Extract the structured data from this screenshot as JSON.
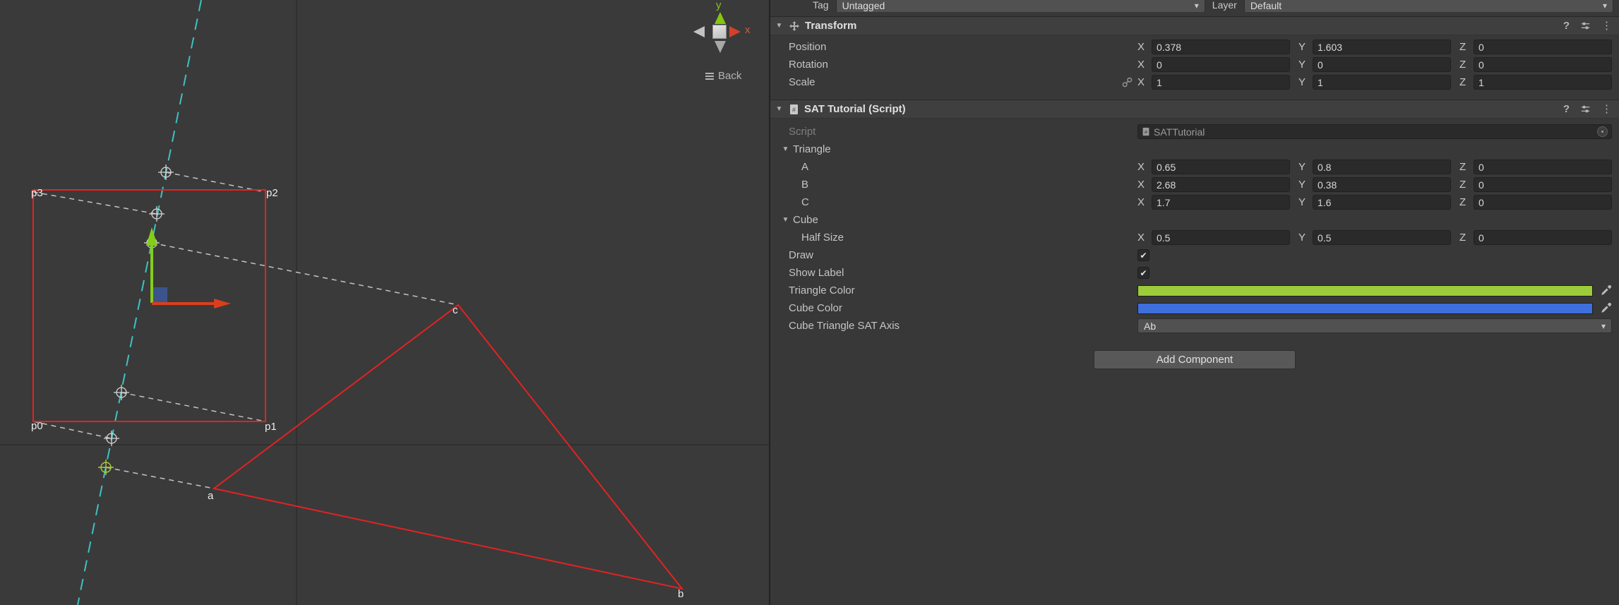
{
  "icons": {
    "help": "?",
    "more": "⋮",
    "caret": "▾",
    "check": "✔",
    "foldout": "▼"
  },
  "axes": {
    "x": "X",
    "y": "Y",
    "z": "Z"
  },
  "topbar": {
    "tag_label": "Tag",
    "tag_value": "Untagged",
    "layer_label": "Layer",
    "layer_value": "Default"
  },
  "scene": {
    "orientation_gizmo": {
      "y_label": "y",
      "x_label": "x",
      "view_label": "Back"
    },
    "point_labels": {
      "p0": "p0",
      "p1": "p1",
      "p2": "p2",
      "p3": "p3",
      "a": "a",
      "b": "b",
      "c": "c"
    }
  },
  "inspector": {
    "transform": {
      "title": "Transform",
      "rows": [
        {
          "label": "Position",
          "x": "0.378",
          "y": "1.603",
          "z": "0"
        },
        {
          "label": "Rotation",
          "x": "0",
          "y": "0",
          "z": "0"
        },
        {
          "label": "Scale",
          "x": "1",
          "y": "1",
          "z": "1"
        }
      ]
    },
    "sat": {
      "title": "SAT Tutorial (Script)",
      "script_label": "Script",
      "script_value": "SATTutorial",
      "triangle_group_label": "Triangle",
      "vectors": [
        {
          "label": "A",
          "x": "0.65",
          "y": "0.8",
          "z": "0"
        },
        {
          "label": "B",
          "x": "2.68",
          "y": "0.38",
          "z": "0"
        },
        {
          "label": "C",
          "x": "1.7",
          "y": "1.6",
          "z": "0"
        }
      ],
      "cube_group_label": "Cube",
      "half_size": {
        "label": "Half Size",
        "x": "0.5",
        "y": "0.5",
        "z": "0"
      },
      "draw_label": "Draw",
      "draw_checked": true,
      "show_label_label": "Show Label",
      "show_label_checked": true,
      "triangle_color_label": "Triangle Color",
      "triangle_color": "#9CCB3B",
      "cube_color_label": "Cube Color",
      "cube_color": "#3E6FDB",
      "sat_axis_label": "Cube Triangle SAT Axis",
      "sat_axis_value": "Ab"
    },
    "add_component_label": "Add Component"
  }
}
